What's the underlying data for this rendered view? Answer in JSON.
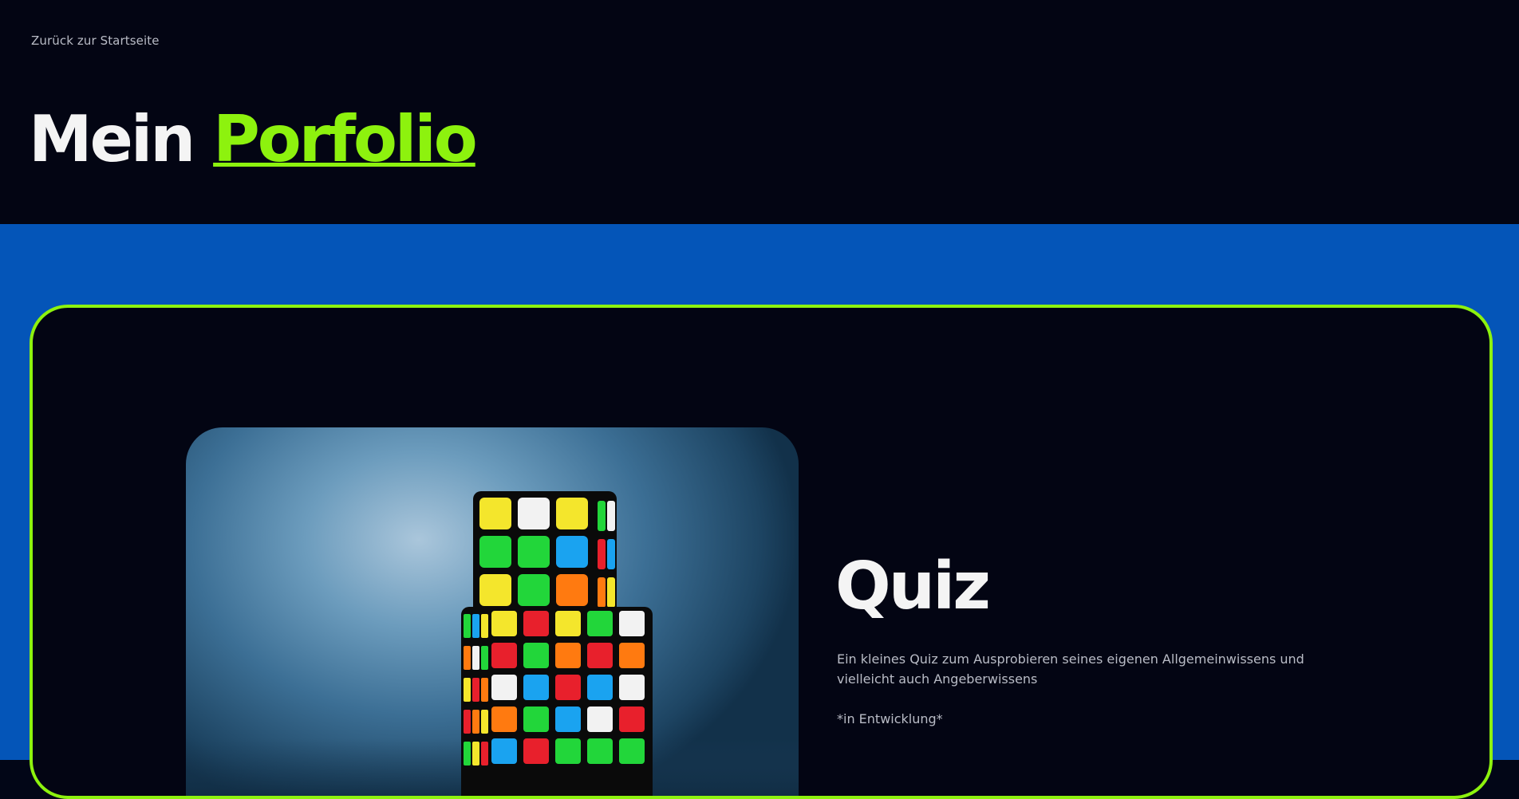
{
  "header": {
    "back_link": "Zurück zur Startseite",
    "title_prefix": "Mein",
    "title_accent": "Porfolio"
  },
  "project": {
    "image_icon": "rubiks-cube-photo",
    "title": "Quiz",
    "description": "Ein kleines Quiz zum Ausprobieren seines eigenen Allgemeinwissens und vielleicht auch Angeberwissens",
    "note": "*in Entwicklung*"
  },
  "colors": {
    "accent": "#8df20e",
    "background": "#030513",
    "band": "#0455b8",
    "text_muted": "#b9bcc6"
  }
}
